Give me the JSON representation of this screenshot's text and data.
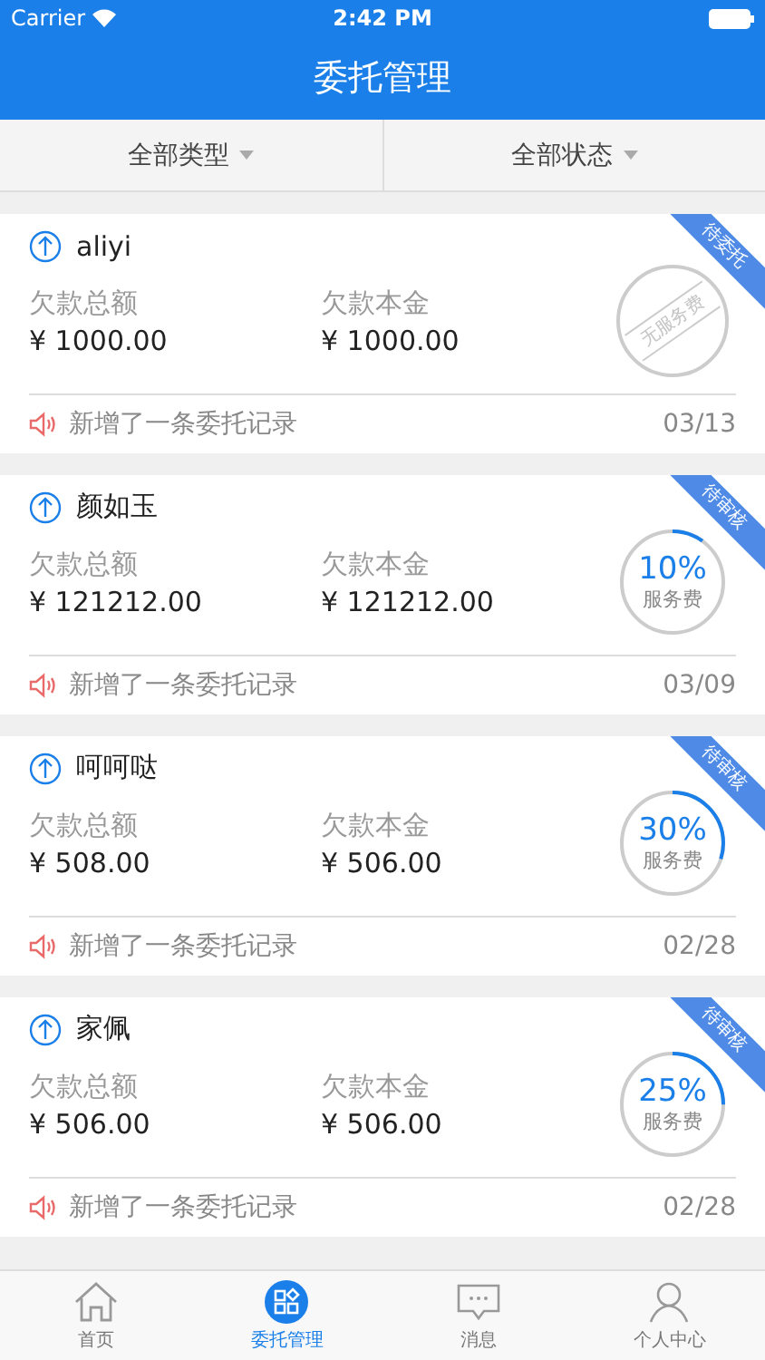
{
  "status_bar": {
    "carrier": "Carrier",
    "time": "2:42 PM"
  },
  "nav": {
    "title": "委托管理"
  },
  "filters": [
    {
      "label": "全部类型"
    },
    {
      "label": "全部状态"
    }
  ],
  "cards": [
    {
      "name": "aliyi",
      "ribbon": "待委托",
      "total_label": "欠款总额",
      "total": "¥ 1000.00",
      "principal_label": "欠款本金",
      "principal": "¥ 1000.00",
      "fee": {
        "kind": "stamp",
        "text": "无服务费"
      },
      "note": "新增了一条委托记录",
      "date": "03/13"
    },
    {
      "name": "颜如玉",
      "ribbon": "待审核",
      "total_label": "欠款总额",
      "total": "¥ 121212.00",
      "principal_label": "欠款本金",
      "principal": "¥ 121212.00",
      "fee": {
        "kind": "ring",
        "percent": "10%",
        "text": "服务费"
      },
      "note": "新增了一条委托记录",
      "date": "03/09"
    },
    {
      "name": "呵呵哒",
      "ribbon": "待审核",
      "total_label": "欠款总额",
      "total": "¥ 508.00",
      "principal_label": "欠款本金",
      "principal": "¥ 506.00",
      "fee": {
        "kind": "ring",
        "percent": "30%",
        "text": "服务费"
      },
      "note": "新增了一条委托记录",
      "date": "02/28"
    },
    {
      "name": "家佩",
      "ribbon": "待审核",
      "total_label": "欠款总额",
      "total": "¥ 506.00",
      "principal_label": "欠款本金",
      "principal": "¥ 506.00",
      "fee": {
        "kind": "ring",
        "percent": "25%",
        "text": "服务费"
      },
      "note": "新增了一条委托记录",
      "date": "02/28"
    }
  ],
  "tabs": [
    {
      "kind": "home",
      "label": "首页",
      "selected": false
    },
    {
      "kind": "grid",
      "label": "委托管理",
      "selected": true
    },
    {
      "kind": "chat",
      "label": "消息",
      "selected": false
    },
    {
      "kind": "user",
      "label": "个人中心",
      "selected": false
    }
  ]
}
